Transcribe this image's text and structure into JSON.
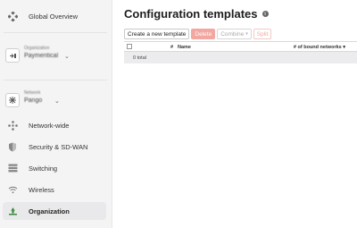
{
  "sidebar": {
    "global_overview": "Global Overview",
    "org_picker": {
      "caption": "Organization",
      "value": "Paymentical"
    },
    "network_picker": {
      "caption": "Network",
      "value": "Pango"
    },
    "items": [
      {
        "label": "Network-wide",
        "icon": "network-wide-icon"
      },
      {
        "label": "Security & SD-WAN",
        "icon": "shield-icon"
      },
      {
        "label": "Switching",
        "icon": "switch-icon"
      },
      {
        "label": "Wireless",
        "icon": "wifi-icon"
      },
      {
        "label": "Organization",
        "icon": "organization-icon",
        "active": true
      }
    ]
  },
  "main": {
    "title": "Configuration templates",
    "toolbar": {
      "create": "Create a new template",
      "delete": "Delete",
      "combine": "Combine",
      "split": "Split"
    },
    "table": {
      "columns": [
        "#",
        "Name",
        "# of bound networks"
      ],
      "sort_indicator": "▾",
      "footer": "0 total"
    }
  },
  "colors": {
    "accent_danger": "#f2a7a1",
    "active_icon": "#3c8a3c"
  }
}
